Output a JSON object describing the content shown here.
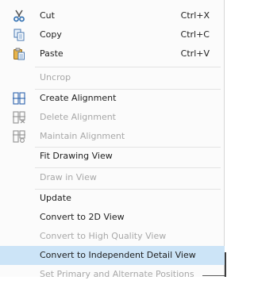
{
  "menu": {
    "cut": {
      "label": "Cut",
      "shortcut": "Ctrl+X",
      "icon": "scissors-icon"
    },
    "copy": {
      "label": "Copy",
      "shortcut": "Ctrl+C",
      "icon": "copy-icon"
    },
    "paste": {
      "label": "Paste",
      "shortcut": "Ctrl+V",
      "icon": "paste-icon"
    },
    "uncrop": {
      "label": "Uncrop"
    },
    "create_alignment": {
      "label": "Create Alignment",
      "icon": "create-alignment-icon"
    },
    "delete_alignment": {
      "label": "Delete Alignment",
      "icon": "delete-alignment-icon"
    },
    "maintain_alignment": {
      "label": "Maintain Alignment",
      "icon": "maintain-alignment-icon"
    },
    "fit_drawing_view": {
      "label": "Fit Drawing View"
    },
    "draw_in_view": {
      "label": "Draw in View"
    },
    "update": {
      "label": "Update"
    },
    "convert_2d": {
      "label": "Convert to 2D View"
    },
    "convert_hq": {
      "label": "Convert to High Quality View"
    },
    "convert_independent": {
      "label": "Convert to Independent Detail View"
    },
    "set_primary": {
      "label": "Set Primary and Alternate Positions"
    }
  },
  "colors": {
    "selected_background": "#cce4f7",
    "disabled_text": "#a8a8a8",
    "text": "#1e1e1e"
  }
}
